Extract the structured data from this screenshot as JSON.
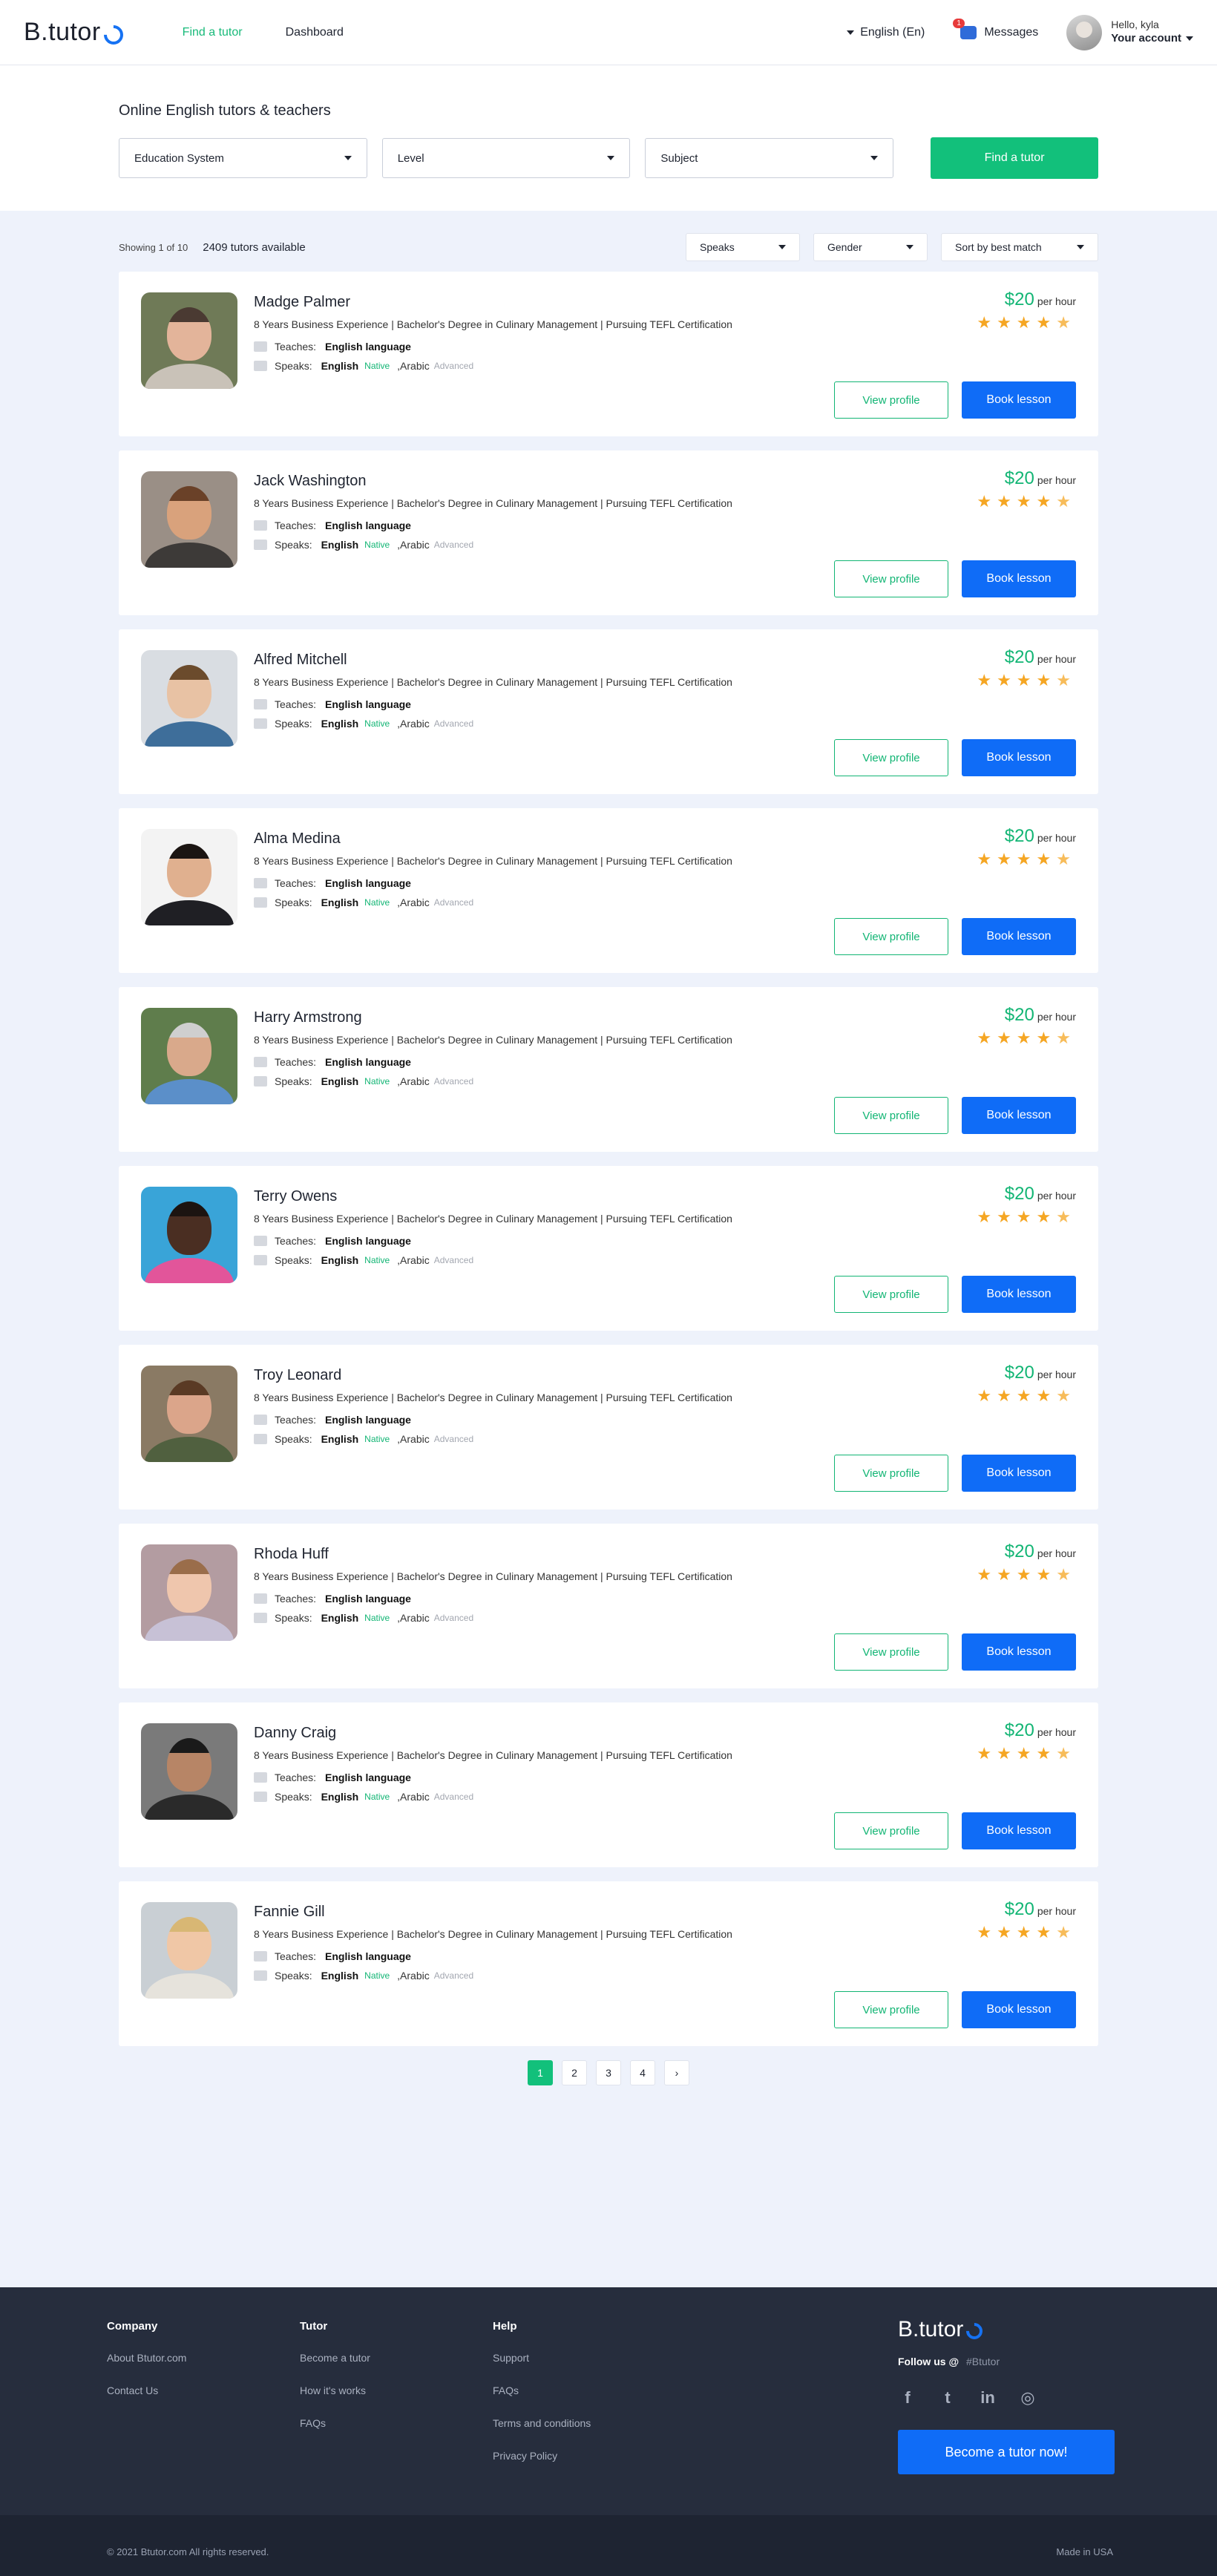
{
  "header": {
    "logo": "B.tutor",
    "nav": [
      {
        "label": "Find a tutor",
        "active": true
      },
      {
        "label": "Dashboard",
        "active": false
      }
    ],
    "language": "English (En)",
    "messages_label": "Messages",
    "messages_count": "1",
    "greeting": "Hello, kyla",
    "account_label": "Your account"
  },
  "search": {
    "title": "Online English tutors & teachers",
    "filters": [
      "Education System",
      "Level",
      "Subject"
    ],
    "find_button": "Find a tutor"
  },
  "list": {
    "showing": "Showing 1 of 10",
    "available": "2409 tutors available",
    "sorts": [
      "Speaks",
      "Gender",
      "Sort by best match"
    ]
  },
  "card_labels": {
    "teaches": "Teaches:",
    "speaks": "Speaks:",
    "per_hour": "per hour",
    "view_profile": "View profile",
    "book_lesson": "Book lesson"
  },
  "tutors": [
    {
      "name": "Madge Palmer",
      "desc": "8 Years Business Experience | Bachelor's Degree in Culinary Management | Pursuing TEFL Certification",
      "teaches": "English language",
      "lang1": "English",
      "lvl1": "Native",
      "lang2": ",Arabic",
      "lvl2": "Advanced",
      "price": "$20",
      "rating": 4.5,
      "skin": "#e3b49a",
      "hair": "#4a3a32",
      "shirt": "#c9c2b8",
      "bg": "#6f7a57"
    },
    {
      "name": "Jack Washington",
      "desc": "8 Years Business Experience | Bachelor's Degree in Culinary Management | Pursuing TEFL Certification",
      "teaches": "English language",
      "lang1": "English",
      "lvl1": "Native",
      "lang2": ",Arabic",
      "lvl2": "Advanced",
      "price": "$20",
      "rating": 4.5,
      "skin": "#d9a27c",
      "hair": "#6a4128",
      "shirt": "#3d3a38",
      "bg": "#9a8f86"
    },
    {
      "name": "Alfred Mitchell",
      "desc": "8 Years Business Experience | Bachelor's Degree in Culinary Management | Pursuing TEFL Certification",
      "teaches": "English language",
      "lang1": "English",
      "lvl1": "Native",
      "lang2": ",Arabic",
      "lvl2": "Advanced",
      "price": "$20",
      "rating": 4.5,
      "skin": "#e8c2a4",
      "hair": "#6b4b2c",
      "shirt": "#3e6e9a",
      "bg": "#d9dde2"
    },
    {
      "name": "Alma Medina",
      "desc": "8 Years Business Experience | Bachelor's Degree in Culinary Management | Pursuing TEFL Certification",
      "teaches": "English language",
      "lang1": "English",
      "lvl1": "Native",
      "lang2": ",Arabic",
      "lvl2": "Advanced",
      "price": "$20",
      "rating": 4.5,
      "skin": "#e0b08f",
      "hair": "#1b1512",
      "shirt": "#1f1f24",
      "bg": "#f3f3f3"
    },
    {
      "name": "Harry Armstrong",
      "desc": "8 Years Business Experience | Bachelor's Degree in Culinary Management | Pursuing TEFL Certification",
      "teaches": "English language",
      "lang1": "English",
      "lvl1": "Native",
      "lang2": ",Arabic",
      "lvl2": "Advanced",
      "price": "$20",
      "rating": 4.5,
      "skin": "#d9a98b",
      "hair": "#cfcfcf",
      "shirt": "#5b8fc9",
      "bg": "#5f7d4c"
    },
    {
      "name": "Terry Owens",
      "desc": "8 Years Business Experience | Bachelor's Degree in Culinary Management | Pursuing TEFL Certification",
      "teaches": "English language",
      "lang1": "English",
      "lvl1": "Native",
      "lang2": ",Arabic",
      "lvl2": "Advanced",
      "price": "$20",
      "rating": 4.5,
      "skin": "#4a2e22",
      "hair": "#1c1411",
      "shirt": "#e2559a",
      "bg": "#39a4d8"
    },
    {
      "name": "Troy Leonard",
      "desc": "8 Years Business Experience | Bachelor's Degree in Culinary Management | Pursuing TEFL Certification",
      "teaches": "English language",
      "lang1": "English",
      "lvl1": "Native",
      "lang2": ",Arabic",
      "lvl2": "Advanced",
      "price": "$20",
      "rating": 4.5,
      "skin": "#dba58a",
      "hair": "#5a3a24",
      "shirt": "#50603f",
      "bg": "#8a7a64"
    },
    {
      "name": "Rhoda Huff",
      "desc": "8 Years Business Experience | Bachelor's Degree in Culinary Management | Pursuing TEFL Certification",
      "teaches": "English language",
      "lang1": "English",
      "lvl1": "Native",
      "lang2": ",Arabic",
      "lvl2": "Advanced",
      "price": "$20",
      "rating": 4.5,
      "skin": "#efc6ad",
      "hair": "#9a6d4a",
      "shirt": "#c7c1d6",
      "bg": "#b39ca1"
    },
    {
      "name": "Danny Craig",
      "desc": "8 Years Business Experience | Bachelor's Degree in Culinary Management | Pursuing TEFL Certification",
      "teaches": "English language",
      "lang1": "English",
      "lvl1": "Native",
      "lang2": ",Arabic",
      "lvl2": "Advanced",
      "price": "$20",
      "rating": 4.5,
      "skin": "#b78566",
      "hair": "#1a1a1a",
      "shirt": "#2a2a2a",
      "bg": "#7a7a7a"
    },
    {
      "name": "Fannie Gill",
      "desc": "8 Years Business Experience | Bachelor's Degree in Culinary Management | Pursuing TEFL Certification",
      "teaches": "English language",
      "lang1": "English",
      "lvl1": "Native",
      "lang2": ",Arabic",
      "lvl2": "Advanced",
      "price": "$20",
      "rating": 4.5,
      "skin": "#f0c7a6",
      "hair": "#d8b774",
      "shirt": "#e6e3dc",
      "bg": "#c9cfd4"
    }
  ],
  "pagination": [
    "1",
    "2",
    "3",
    "4"
  ],
  "pagination_next": "›",
  "footer": {
    "company_title": "Company",
    "company_links": [
      "About Btutor.com",
      "Contact Us"
    ],
    "tutor_title": "Tutor",
    "tutor_links": [
      "Become a tutor",
      "How it's works",
      "FAQs"
    ],
    "help_title": "Help",
    "help_links": [
      "Support",
      "FAQs",
      "Terms and conditions",
      "Privacy Policy"
    ],
    "logo": "B.tutor",
    "follow_label": "Follow us @",
    "follow_handle": "#Btutor",
    "socials": [
      "facebook-icon",
      "twitter-icon",
      "linkedin-icon",
      "instagram-icon"
    ],
    "become_button": "Become a tutor now!",
    "copyright": "© 2021 Btutor.com  All rights reserved.",
    "made_in": "Made in USA"
  },
  "colors": {
    "accent_green": "#12c07b",
    "primary_blue": "#0f6cf7",
    "star": "#f5a623"
  }
}
